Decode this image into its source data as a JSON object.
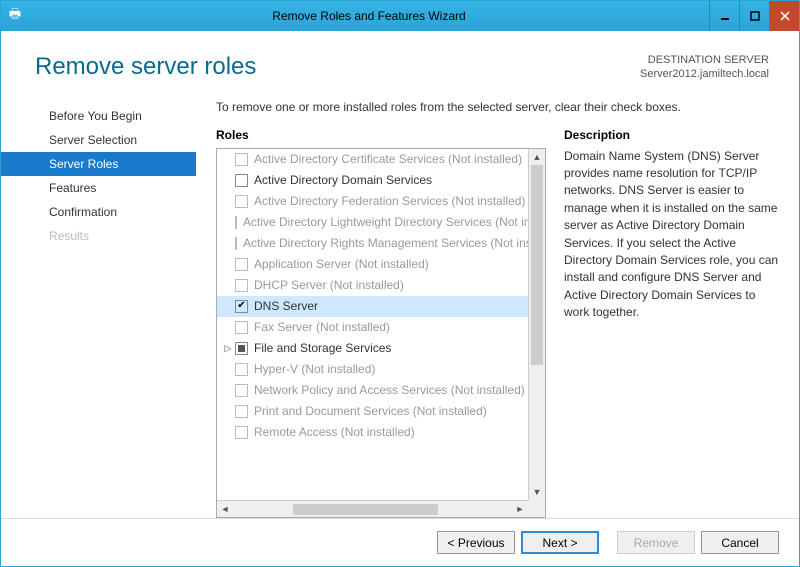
{
  "window": {
    "title": "Remove Roles and Features Wizard"
  },
  "header": {
    "page_title": "Remove server roles",
    "dest_label": "DESTINATION SERVER",
    "dest_name": "Server2012.jamiltech.local"
  },
  "nav": {
    "items": [
      {
        "label": "Before You Begin",
        "active": false
      },
      {
        "label": "Server Selection",
        "active": false
      },
      {
        "label": "Server Roles",
        "active": true
      },
      {
        "label": "Features",
        "active": false
      },
      {
        "label": "Confirmation",
        "active": false
      },
      {
        "label": "Results",
        "active": false,
        "disabled": true
      }
    ]
  },
  "main": {
    "instruction": "To remove one or more installed roles from the selected server, clear their check boxes.",
    "roles_heading": "Roles",
    "desc_heading": "Description",
    "description": "Domain Name System (DNS) Server provides name resolution for TCP/IP networks. DNS Server is easier to manage when it is installed on the same server as Active Directory Domain Services. If you select the Active Directory Domain Services role, you can install and configure DNS Server and Active Directory Domain Services to work together.",
    "roles": [
      {
        "label": "Active Directory Certificate Services (Not installed)",
        "state": "dis"
      },
      {
        "label": "Active Directory Domain Services",
        "state": "unchecked"
      },
      {
        "label": "Active Directory Federation Services (Not installed)",
        "state": "dis"
      },
      {
        "label": "Active Directory Lightweight Directory Services (Not installed)",
        "state": "dis"
      },
      {
        "label": "Active Directory Rights Management Services (Not installed)",
        "state": "dis"
      },
      {
        "label": "Application Server (Not installed)",
        "state": "dis"
      },
      {
        "label": "DHCP Server (Not installed)",
        "state": "dis"
      },
      {
        "label": "DNS Server",
        "state": "checked",
        "selected": true
      },
      {
        "label": "Fax Server (Not installed)",
        "state": "dis"
      },
      {
        "label": "File and Storage Services",
        "state": "ind",
        "expander": true
      },
      {
        "label": "Hyper-V (Not installed)",
        "state": "dis"
      },
      {
        "label": "Network Policy and Access Services (Not installed)",
        "state": "dis"
      },
      {
        "label": "Print and Document Services (Not installed)",
        "state": "dis"
      },
      {
        "label": "Remote Access (Not installed)",
        "state": "dis"
      }
    ]
  },
  "footer": {
    "previous": "< Previous",
    "next": "Next >",
    "remove": "Remove",
    "cancel": "Cancel"
  }
}
